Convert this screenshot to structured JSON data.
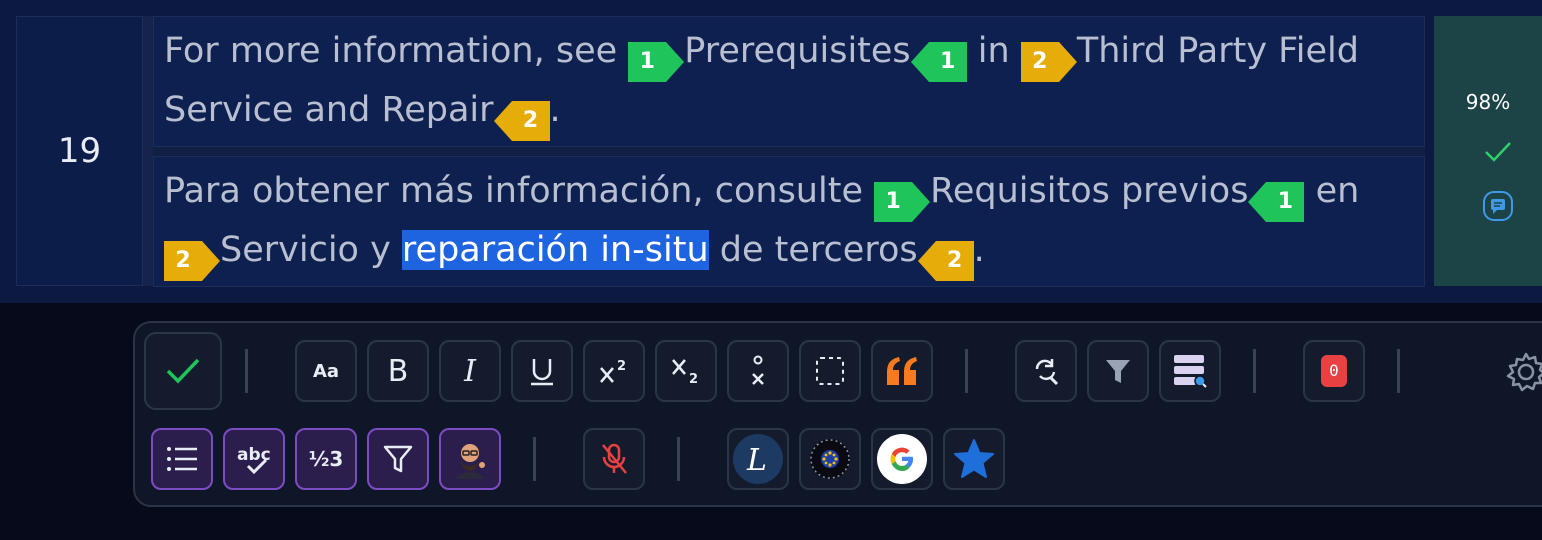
{
  "segment": {
    "number": "19",
    "match_percent": "98%",
    "source": {
      "p1": "For more information, see ",
      "t1": "1",
      "p2": "Prerequisites",
      "t1c": "1",
      "p3": " in ",
      "t2": "2",
      "p4": "Third Party Field Service and Repair",
      "t2c": "2",
      "p5": "."
    },
    "target": {
      "p1": "Para obtener más información, consulte ",
      "t1": "1",
      "p2": "Requisitos previos",
      "t1c": "1",
      "p3": " en ",
      "t2": "2",
      "p4a": "Servicio y ",
      "p4hl": "reparación in-situ",
      "p4b": " de terceros",
      "t2c": "2",
      "p5": "."
    }
  },
  "toolbar": {
    "qa_badge_count": "0",
    "case_label": "Aa",
    "bold_label": "B",
    "italic_label": "I",
    "numbering_label": "½3",
    "accent_color": "#1fc45a",
    "tag_colors": {
      "tag1": "#1fc45a",
      "tag2": "#e5ac0a"
    }
  }
}
